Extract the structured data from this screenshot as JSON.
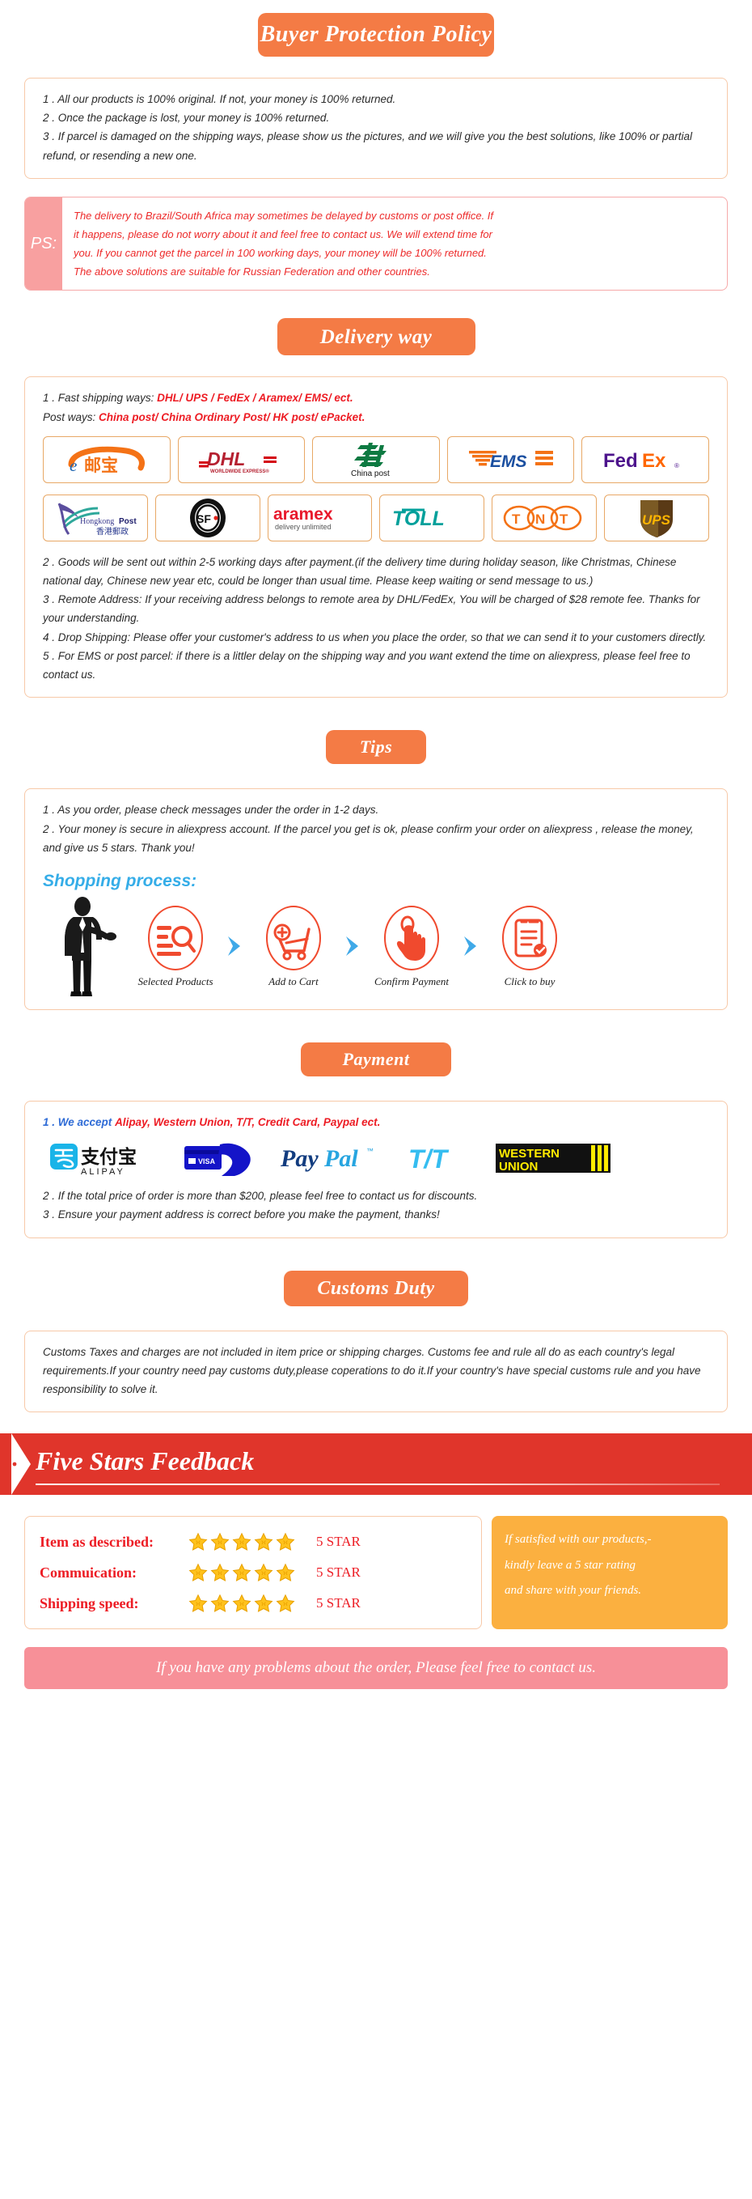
{
  "sections": {
    "buyer_protection": {
      "title": "Buyer Protection Policy",
      "items": [
        "1 . All our products is 100% original. If not, your money is 100% returned.",
        "2 . Once the package is lost, your money is 100% returned.",
        "3 . If parcel is damaged on the shipping ways, please show us the pictures, and we will give you the best solutions, like 100% or partial refund, or resending a new one."
      ]
    },
    "ps": {
      "tag": "PS:",
      "lines": [
        "The delivery to Brazil/South Africa may sometimes be delayed by customs or post office. If",
        "it happens, please do not worry about it and feel free to contact us. We will extend time for",
        "you. If you cannot get the parcel in 100 working days, your money will be 100% returned.",
        "The above solutions are suitable for Russian Federation and other countries."
      ]
    },
    "delivery": {
      "title": "Delivery way",
      "fast_label": "1 . Fast shipping ways:",
      "fast_value": "DHL/ UPS / FedEx / Aramex/ EMS/ ect.",
      "post_label": "Post ways:",
      "post_value": "China post/ China Ordinary Post/ HK post/ ePacket.",
      "carriers_row1": [
        {
          "name": "ems-china-epacket-logo",
          "label": "e邮宝"
        },
        {
          "name": "dhl-logo",
          "label": "DHL"
        },
        {
          "name": "china-post-logo",
          "label": "China post"
        },
        {
          "name": "ems-logo",
          "label": "EMS"
        },
        {
          "name": "fedex-logo",
          "label": "FedEx"
        }
      ],
      "carriers_row2": [
        {
          "name": "hongkong-post-logo",
          "label": "Hongkong Post 香港郵政"
        },
        {
          "name": "sf-express-logo",
          "label": "SF"
        },
        {
          "name": "aramex-logo",
          "label": "aramex delivery unlimited"
        },
        {
          "name": "toll-logo",
          "label": "TOLL"
        },
        {
          "name": "tnt-logo",
          "label": "TNT"
        },
        {
          "name": "ups-logo",
          "label": "UPS"
        }
      ],
      "notes": [
        "2 . Goods will be sent out within 2-5 working days after payment.(if the delivery time during holiday season, like Christmas, Chinese national day, Chinese new year etc, could be longer than usual time. Please keep waiting or send message to us.)",
        "3 . Remote Address: If your receiving address belongs to remote area by DHL/FedEx, You will be charged of $28 remote fee. Thanks for your understanding.",
        "4 . Drop Shipping: Please offer your customer's address to us when you place the order, so that we can send it to your customers directly.",
        "5 . For EMS or post parcel: if there is a littler delay on the shipping way and you want extend the time on aliexpress, please feel free to contact us."
      ]
    },
    "tips": {
      "title": "Tips",
      "items": [
        "1 .  As you order, please check messages under the order in 1-2 days.",
        "2 . Your money is secure in aliexpress account. If the parcel you get is ok, please confirm your order on aliexpress , release the money, and give us 5 stars. Thank you!"
      ],
      "process_title": "Shopping process:",
      "steps": [
        {
          "icon": "search-list-icon",
          "label": "Selected Products"
        },
        {
          "icon": "add-to-cart-icon",
          "label": "Add to Cart"
        },
        {
          "icon": "hand-click-icon",
          "label": "Confirm Payment"
        },
        {
          "icon": "checklist-icon",
          "label": "Click to buy"
        }
      ]
    },
    "payment": {
      "title": "Payment",
      "accept_label": "1 . We accept",
      "accept_value": "Alipay, Western Union, T/T, Credit Card, Paypal ect.",
      "methods": [
        {
          "name": "alipay-logo",
          "label": "支付宝 ALIPAY"
        },
        {
          "name": "visa-credit-card-icon",
          "label": "VISA"
        },
        {
          "name": "paypal-logo",
          "label": "PayPal"
        },
        {
          "name": "tt-transfer-logo",
          "label": "T/T"
        },
        {
          "name": "western-union-logo",
          "label": "WESTERN UNION"
        }
      ],
      "notes": [
        "2 . If the total price of order is more than $200, please feel free to contact us for discounts.",
        "3 . Ensure your payment address is correct before you make the payment, thanks!"
      ]
    },
    "customs": {
      "title": "Customs Duty",
      "body": "Customs Taxes and charges are not included in item price or shipping charges. Customs fee and rule all do as each country's legal requirements.If your country need pay customs duty,please coperations to do it.If your country's have special customs rule and you have responsibility to solve it."
    },
    "feedback": {
      "title": "Five Stars Feedback",
      "ratings": [
        {
          "label": "Item as described:",
          "stars": 5,
          "value": "5 STAR"
        },
        {
          "label": "Commuication:",
          "stars": 5,
          "value": "5 STAR"
        },
        {
          "label": "Shipping speed:",
          "stars": 5,
          "value": "5 STAR"
        }
      ],
      "note_lines": [
        "If satisfied with our products,-",
        "kindly leave a 5 star rating",
        "and share with your friends."
      ],
      "contact_bar": "If you have any problems about the order, Please feel free to contact us."
    }
  },
  "colors": {
    "accent_orange": "#F47B45",
    "red": "#ED1C24",
    "banner_red": "#E0352B",
    "note_amber": "#FBB040",
    "pink_bar": "#F79098",
    "ps_pink": "#F8A0A0",
    "blue": "#35ADE8",
    "card_border": "#F7C9A8"
  }
}
